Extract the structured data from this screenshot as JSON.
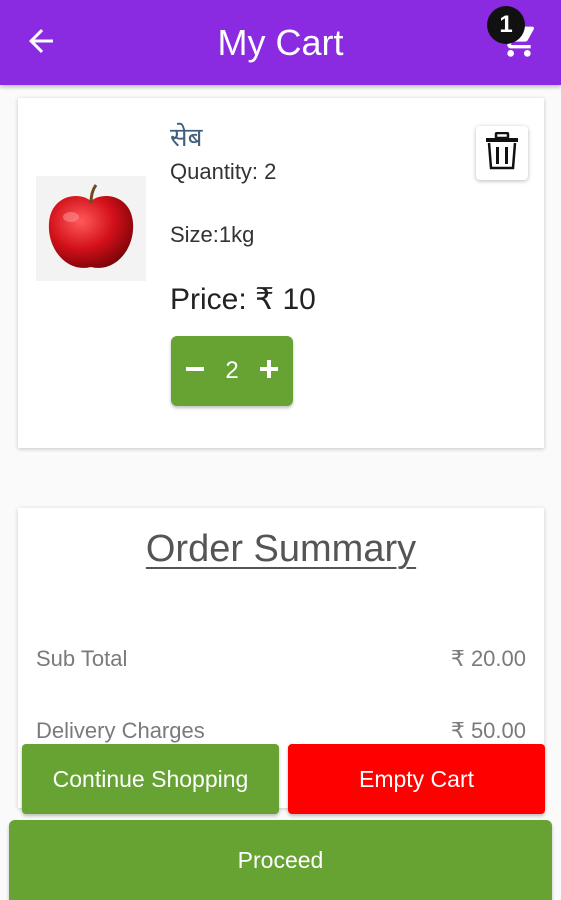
{
  "header": {
    "title": "My Cart",
    "cart_badge": "1"
  },
  "item": {
    "name": "सेब",
    "quantity_text": "Quantity: 2",
    "size_text": "Size:1kg",
    "price_text": "Price: ₹ 10",
    "stepper_count": "2"
  },
  "summary": {
    "title": "Order Summary",
    "rows": [
      {
        "label": "Sub Total",
        "value": "₹ 20.00"
      },
      {
        "label": "Delivery Charges",
        "value": "₹ 50.00"
      }
    ]
  },
  "actions": {
    "continue_label": "Continue Shopping",
    "empty_label": "Empty Cart",
    "proceed_label": "Proceed"
  },
  "colors": {
    "header": "#8a2be2",
    "green": "#66a332",
    "red": "#ff0000"
  },
  "icons": [
    "back-arrow-icon",
    "cart-icon",
    "trash-icon",
    "minus-icon",
    "plus-icon"
  ]
}
